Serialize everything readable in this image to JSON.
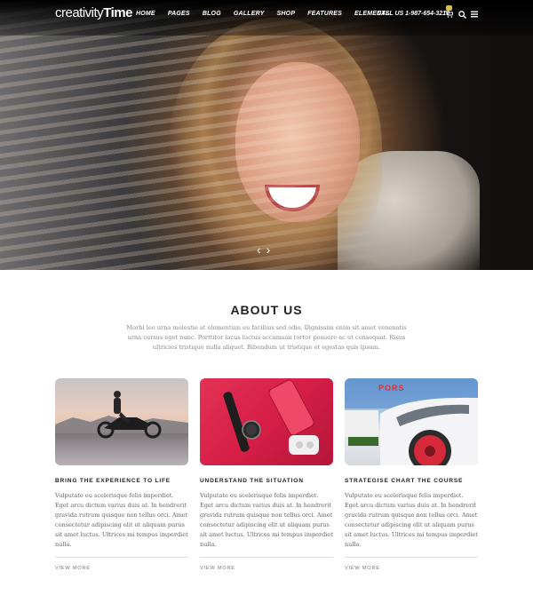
{
  "nav": {
    "brand_light": "creativity",
    "brand_bold": "Time",
    "links": [
      "HOME",
      "PAGES",
      "BLOG",
      "GALLERY",
      "SHOP",
      "FEATURES",
      "ELEMENTS"
    ],
    "call": "CALL US 1-987-654-3210"
  },
  "hero": {
    "prev_arrow": "‹",
    "next_arrow": "›"
  },
  "about": {
    "title": "ABOUT US",
    "text": "Morbi leo urna molestie at elementum eu facilisis sed odio. Dignissim enim sit amet venenatis urna cursus eget nunc. Porttitor lacus luctus accumsan tortor posuere ac ut consequat. Risus ultricies tristique nulla aliquet. Bibendum ut tristique et egestas quis ipsum."
  },
  "cards": [
    {
      "title": "BRING THE EXPERIENCE TO LIFE",
      "text": "Vulputate eu scelerisque felis imperdiet. Eget arcu dictum varius duis at. In hendrerit gravida rutrum quisque non tellus orci. Amet consectetur adipiscing elit ut aliquam purus sit amet luctus. Ultrices mi tempus imperdiet nulla.",
      "link": "VIEW MORE"
    },
    {
      "title": "UNDERSTAND THE SITUATION",
      "text": "Vulputate eu scelerisque felis imperdiet. Eget arcu dictum varius duis at. In hendrerit gravida rutrum quisque non tellus orci. Amet consectetur adipiscing elit ut aliquam purus sit amet luctus. Ultrices mi tempus imperdiet nulla.",
      "link": "VIEW MORE"
    },
    {
      "title": "STRATEGISE CHART THE COURSE",
      "text": "Vulputate eu scelerisque felis imperdiet. Eget arcu dictum varius duis at. In hendrerit gravida rutrum quisque non tellus orci. Amet consectetur adipiscing elit ut aliquam purus sit amet luctus. Ultrices mi tempus imperdiet nulla.",
      "link": "VIEW MORE"
    }
  ],
  "colors": {
    "accent_red": "#d61e46",
    "badge_gold": "#d4c24c"
  }
}
